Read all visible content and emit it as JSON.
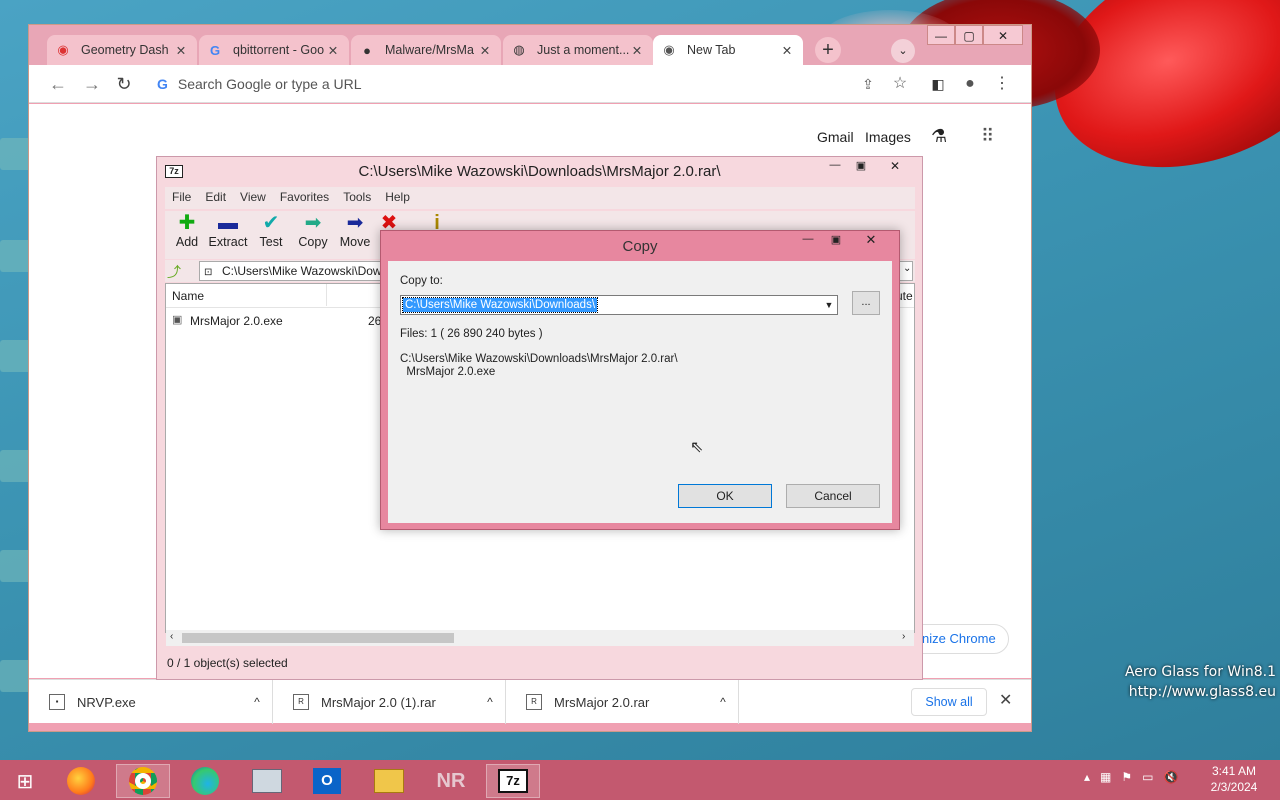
{
  "desktop": {
    "watermark_line1": "Aero Glass for Win8.1",
    "watermark_line2": "http://www.glass8.eu"
  },
  "chrome": {
    "tabs": [
      {
        "title": "Geometry Dash",
        "icon": "ghost-icon"
      },
      {
        "title": "qbittorrent - Goo",
        "icon": "google-icon"
      },
      {
        "title": "Malware/MrsMa",
        "icon": "github-icon"
      },
      {
        "title": "Just a moment...",
        "icon": "globe-icon"
      },
      {
        "title": "New Tab",
        "icon": "chrome-icon"
      }
    ],
    "omnibox_placeholder": "Search Google or type a URL",
    "gmail": "Gmail",
    "images": "Images",
    "customize": "nize Chrome",
    "downloads": [
      {
        "name": "NRVP.exe"
      },
      {
        "name": "MrsMajor 2.0 (1).rar"
      },
      {
        "name": "MrsMajor 2.0.rar"
      }
    ],
    "show_all": "Show all"
  },
  "zip": {
    "title": "C:\\Users\\Mike Wazowski\\Downloads\\MrsMajor 2.0.rar\\",
    "menu": [
      "File",
      "Edit",
      "View",
      "Favorites",
      "Tools",
      "Help"
    ],
    "toolbar": [
      "Add",
      "Extract",
      "Test",
      "Copy",
      "Move"
    ],
    "address": "C:\\Users\\Mike Wazowski\\Dow",
    "col_name": "Name",
    "col_right": "ute",
    "file_name": "MrsMajor 2.0.exe",
    "file_size_partial": "26",
    "status": "0 / 1 object(s) selected"
  },
  "dialog": {
    "title": "Copy",
    "copy_to_label": "Copy to:",
    "copy_to_value": "C:\\Users\\Mike Wazowski\\Downloads\\",
    "browse": "...",
    "files_info": "Files: 1    ( 26 890 240 bytes )",
    "path_line1": "C:\\Users\\Mike Wazowski\\Downloads\\MrsMajor 2.0.rar\\",
    "path_line2": "  MrsMajor 2.0.exe",
    "ok": "OK",
    "cancel": "Cancel"
  },
  "taskbar": {
    "time": "3:41 AM",
    "date": "2/3/2024",
    "apps": [
      "start-button",
      "firefox-icon",
      "chrome-icon",
      "edge-icon",
      "task-manager-icon",
      "outlook-icon",
      "file-explorer-icon",
      "nr-icon",
      "7zip-icon"
    ]
  }
}
